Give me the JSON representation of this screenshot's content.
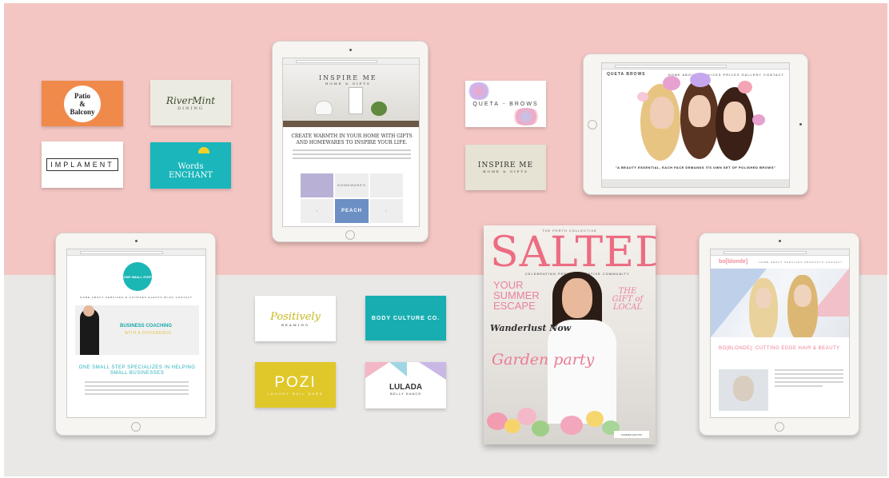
{
  "cards": {
    "patio": {
      "line1": "Patio",
      "line2": "&",
      "line3": "Balcony"
    },
    "river": {
      "name": "RiverMint",
      "tag": "DINING"
    },
    "implament": {
      "name": "IMPLAMENT"
    },
    "words": {
      "line1": "Words",
      "line2": "ENCHANT"
    },
    "queta": {
      "name": "QUETA",
      "name2": "BROWS"
    },
    "inspire": {
      "name": "INSPIRE ME",
      "tag": "HOME & GIFTS"
    },
    "positively": {
      "name": "Positively",
      "tag": "BEAMING"
    },
    "body": {
      "name": "BODY CULTURE CO."
    },
    "pozi": {
      "name": "POZI",
      "tag": "LUXURY NAIL BARS"
    },
    "lulada": {
      "name": "LULADA",
      "tag": "BELLY DANCE"
    }
  },
  "tablets": {
    "inspire": {
      "logo": "INSPIRE ME",
      "logo_sub": "HOME & GIFTS",
      "headline": "CREATE WARMTH IN YOUR HOME WITH GIFTS AND HOMEWARES TO INSPIRE YOUR LIFE.",
      "tile_label": "HOMEWARES",
      "tile_peach": "PEACH"
    },
    "queta": {
      "brand": "QUETA BROWS",
      "nav": "HOME  ABOUT  SERVICES  PRICES  GALLERY  CONTACT",
      "quote": "\"A BEAUTY ESSENTIAL, EACH FACE DEMANDS ITS OWN SET OF POLISHED BROWS\""
    },
    "small_step": {
      "logo": "ONE SMALL STEP",
      "nav": "HOME  ABOUT  SERVICES  E-COURSES  EVENTS  BLOG  CONTACT",
      "band_title": "BUSINESS COACHING",
      "band_sub": "WITH A DIFFERENCE",
      "headline": "ONE SMALL STEP SPECIALIZES IN HELPING SMALL BUSINESSES"
    },
    "blonde": {
      "logo": "bo[blonde]",
      "nav": "HOME  ABOUT  SERVICES  PRODUCTS  CONTACT",
      "title": "BO[BLONDE]: CUTTING EDGE HAIR & BEAUTY"
    }
  },
  "magazine": {
    "top": "THE PERTH COLLECTIVE",
    "title": "SALTED",
    "subtitle": "CELEBRATING PERTH'S CREATIVE COMMUNITY",
    "left_line1": "YOUR",
    "left_line2": "SUMMER",
    "left_line3": "ESCAPE",
    "gift": "THE GIFT of LOCAL",
    "wanderlust": "Wanderlust Now",
    "garden": "Garden party",
    "badge": "SUMMER EDITION"
  },
  "colors": {
    "wall_top": "#f4c6c3",
    "wall_bottom": "#e9e8e6",
    "accent_pink": "#ec6c82",
    "accent_teal": "#1ab6bb"
  }
}
